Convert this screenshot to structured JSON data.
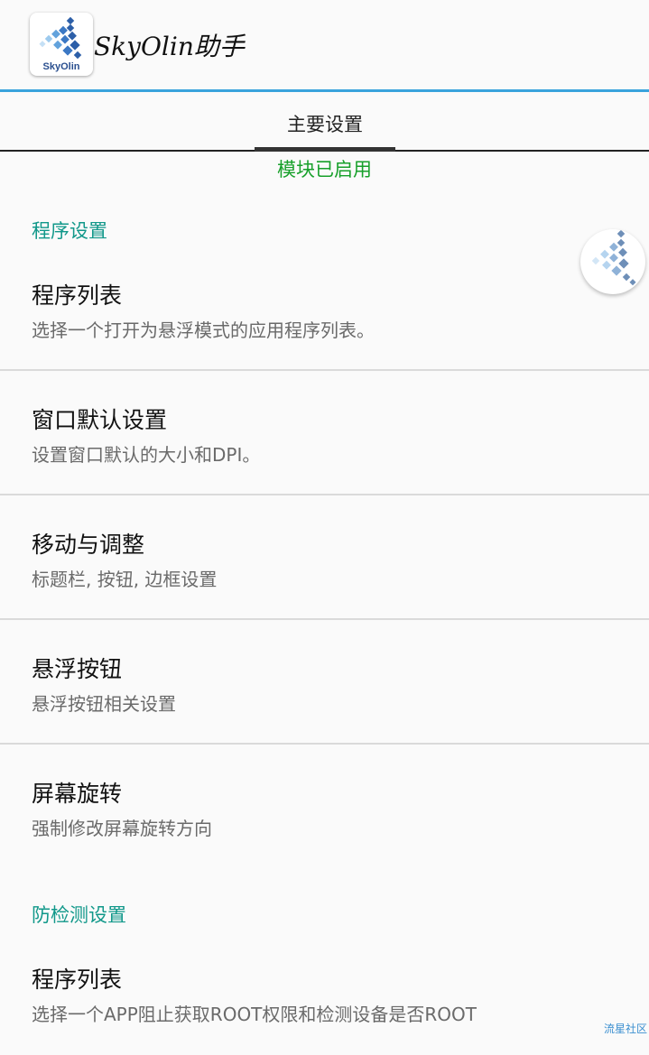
{
  "header": {
    "app_name": "SkyOlin助手",
    "logo_text": "SkyOlin"
  },
  "tabs": [
    {
      "label": "主要设置",
      "selected": true
    }
  ],
  "module_status": "模块已启用",
  "sections": [
    {
      "header": "程序设置",
      "items": [
        {
          "title": "程序列表",
          "summary": "选择一个打开为悬浮模式的应用程序列表。"
        },
        {
          "title": "窗口默认设置",
          "summary": "设置窗口默认的大小和DPI。"
        },
        {
          "title": "移动与调整",
          "summary": "标题栏, 按钮, 边框设置"
        },
        {
          "title": "悬浮按钮",
          "summary": "悬浮按钮相关设置"
        },
        {
          "title": "屏幕旋转",
          "summary": "强制修改屏幕旋转方向"
        }
      ]
    },
    {
      "header": "防检测设置",
      "items": [
        {
          "title": "程序列表",
          "summary": "选择一个APP阻止获取ROOT权限和检测设备是否ROOT"
        }
      ]
    }
  ],
  "watermark": "流星社区",
  "colors": {
    "accent_line": "#3aa3dc",
    "module_status": "#17a02a",
    "section_header": "#11988a"
  },
  "icons": {
    "app_logo": "skyolin-logo-icon",
    "floating_button": "skyolin-float-icon"
  }
}
